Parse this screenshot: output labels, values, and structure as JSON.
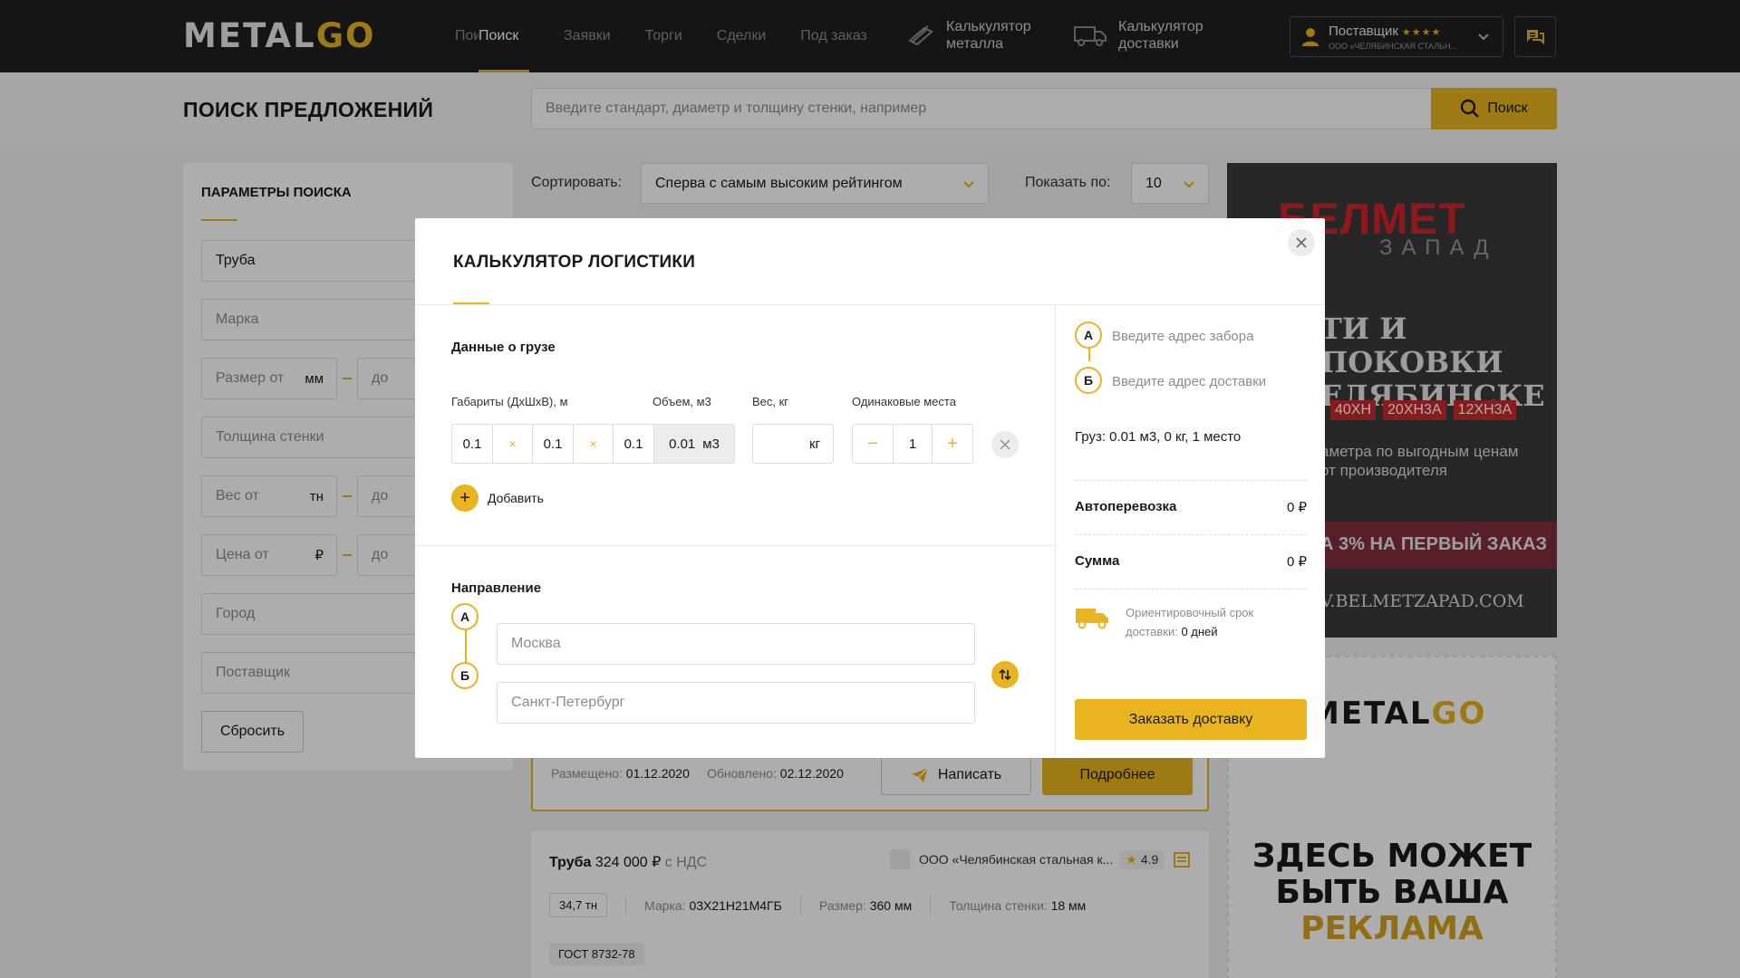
{
  "header": {
    "logo_main": "METAL",
    "logo_accent": "GO",
    "nav": [
      "Поиск",
      "Поиск",
      "Заявки",
      "Торги",
      "Сделки",
      "Под заказ"
    ],
    "calc_metal_line1": "Калькулятор",
    "calc_metal_line2": "металла",
    "calc_delivery_line1": "Калькулятор",
    "calc_delivery_line2": "доставки",
    "supplier_name": "Поставщик",
    "supplier_stars": "★★★★",
    "supplier_company": "ООО «ЧЕЛЯБИНСКАЯ СТАЛЬН..."
  },
  "titlebar": {
    "title": "ПОИСК ПРЕДЛОЖЕНИЙ",
    "search_placeholder": "Введите стандарт, диаметр и толщину стенки, например",
    "search_button": "Поиск"
  },
  "sidebar": {
    "title": "ПАРАМЕТРЫ ПОИСКА",
    "product": "Труба",
    "grade": "Марка",
    "size_from": "Размер от",
    "size_unit": "мм",
    "size_to": "до",
    "wall": "Толщина стенки",
    "weight_from": "Вес от",
    "weight_unit": "тн",
    "weight_to": "до",
    "price_from": "Цена от",
    "price_unit": "₽",
    "price_to": "до",
    "city": "Город",
    "supplier": "Поставщик",
    "reset": "Сбросить"
  },
  "sorting": {
    "sort_label": "Сортировать:",
    "sort_value": "Сперва с самым высоким рейтингом",
    "show_label": "Показать по:",
    "show_value": "10"
  },
  "card1": {
    "posted_label": "Размещено:",
    "posted": "01.12.2020",
    "updated_label": "Обновлено:",
    "updated": "02.12.2020",
    "write": "Написать",
    "more": "Подробнее"
  },
  "card2": {
    "product": "Труба",
    "price": "324 000 ₽",
    "vat": "с НДС",
    "company": "ООО «Челябинская стальная к...",
    "rating": "4.9",
    "amount": "34,7 тн",
    "grade_label": "Марка:",
    "grade": "03Х21Н21М4ГБ",
    "size_label": "Размер:",
    "size": "360 мм",
    "wall_label": "Толщина стенки:",
    "wall": "18 мм",
    "gost": "ГОСТ 8732-78"
  },
  "ad1": {
    "brand": "БЕЛМЕТ",
    "sub": "ЗАПАД",
    "headline1": "ТИ И ПОКОВКИ",
    "headline2": "ЕЛЯБИНСКЕ",
    "chips": [
      "40ХН",
      "20ХН3А",
      "12ХН3А"
    ],
    "text1": "аметра по выгодным ценам",
    "text2": "от производителя",
    "promo": "А 3% НА ПЕРВЫЙ ЗАКАЗ",
    "url": "V.BELMETZAPAD.COM"
  },
  "ad2": {
    "logo_main": "METAL",
    "logo_accent": "GO",
    "line1": "ЗДЕСЬ МОЖЕТ",
    "line2": "БЫТЬ ВАША",
    "line3": "РЕКЛАМА"
  },
  "modal": {
    "title": "КАЛЬКУЛЯТОР ЛОГИСТИКИ",
    "cargo_title": "Данные о грузе",
    "dims_label": "Габариты (ДхШхВ), м",
    "volume_label": "Объем, м3",
    "weight_label": "Вес, кг",
    "places_label": "Одинаковые места",
    "dim_l": "0.1",
    "dim_w": "0.1",
    "dim_h": "0.1",
    "dim_sep": "×",
    "volume": "0.01",
    "volume_unit": "м3",
    "weight_unit": "кг",
    "places": "1",
    "add": "Добавить",
    "direction_title": "Направление",
    "point_a": "А",
    "point_b": "Б",
    "from_placeholder": "Москва",
    "to_placeholder": "Санкт-Петербург",
    "pickup_placeholder": "Введите адрес забора",
    "delivery_placeholder": "Введите адрес доставки",
    "cargo_summary": "Груз: 0.01 м3, 0 кг, 1 место",
    "road_label": "Автоперевозка",
    "road_value": "0 ₽",
    "sum_label": "Сумма",
    "sum_value": "0 ₽",
    "eta_line1": "Ориентировочный срок",
    "eta_line2": "доставки:",
    "eta_value": "0 дней",
    "order_button": "Заказать доставку"
  },
  "colors": {
    "accent": "#e9b420",
    "header_bg": "#1f1f1f",
    "overlay": "rgba(0,0,0,0.32)"
  }
}
